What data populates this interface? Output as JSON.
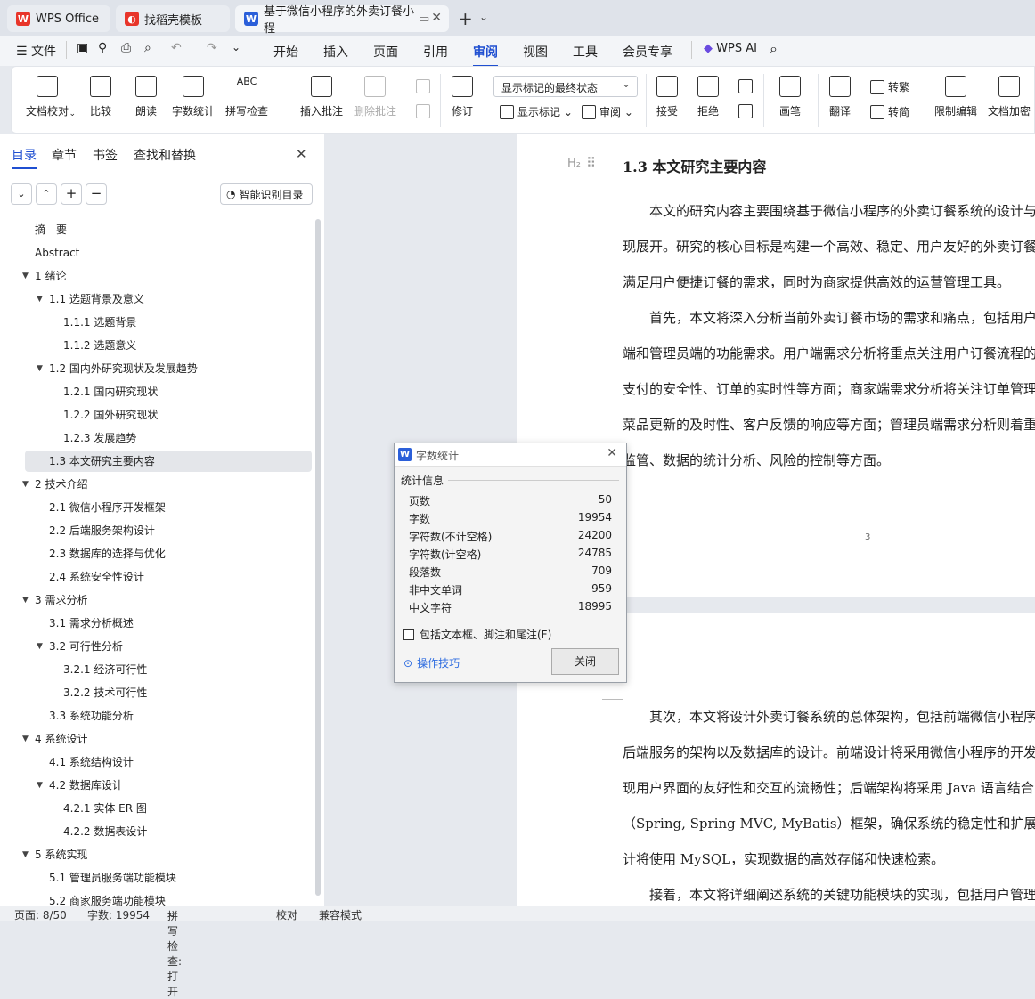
{
  "tabs": [
    {
      "label": "WPS Office"
    },
    {
      "label": "找稻壳模板"
    },
    {
      "label": "基于微信小程序的外卖订餐小程"
    }
  ],
  "menu": {
    "file": "文件",
    "items": [
      "开始",
      "插入",
      "页面",
      "引用",
      "审阅",
      "视图",
      "工具",
      "会员专享"
    ],
    "ai": "WPS AI"
  },
  "ribbon": {
    "big": [
      "文档校对",
      "比较",
      "朗读",
      "字数统计",
      "拼写检查",
      "插入批注",
      "删除批注",
      "修订",
      "接受",
      "拒绝",
      "画笔",
      "翻译",
      "限制编辑",
      "文档加密"
    ],
    "select": "显示标记的最终状态",
    "show_markup": "显示标记",
    "review": "审阅",
    "trad": "转繁",
    "simp": "转简"
  },
  "sidebar": {
    "tabs": [
      "目录",
      "章节",
      "书签",
      "查找和替换"
    ],
    "smart": "智能识别目录",
    "toc": [
      {
        "t": "摘　要",
        "l": 0
      },
      {
        "t": "Abstract",
        "l": 0
      },
      {
        "t": "1  绪论",
        "l": 0,
        "a": 1
      },
      {
        "t": "1.1  选题背景及意义",
        "l": 1,
        "a": 1
      },
      {
        "t": "1.1.1  选题背景",
        "l": 2
      },
      {
        "t": "1.1.2  选题意义",
        "l": 2
      },
      {
        "t": "1.2  国内外研究现状及发展趋势",
        "l": 1,
        "a": 1
      },
      {
        "t": "1.2.1  国内研究现状",
        "l": 2
      },
      {
        "t": "1.2.2  国外研究现状",
        "l": 2
      },
      {
        "t": "1.2.3  发展趋势",
        "l": 2
      },
      {
        "t": "1.3  本文研究主要内容",
        "l": 1,
        "hl": 1
      },
      {
        "t": "2  技术介绍",
        "l": 0,
        "a": 1
      },
      {
        "t": "2.1  微信小程序开发框架",
        "l": 1
      },
      {
        "t": "2.2  后端服务架构设计",
        "l": 1
      },
      {
        "t": "2.3  数据库的选择与优化",
        "l": 1
      },
      {
        "t": "2.4  系统安全性设计",
        "l": 1
      },
      {
        "t": "3  需求分析",
        "l": 0,
        "a": 1
      },
      {
        "t": "3.1  需求分析概述",
        "l": 1
      },
      {
        "t": "3.2  可行性分析",
        "l": 1,
        "a": 1
      },
      {
        "t": "3.2.1  经济可行性",
        "l": 2
      },
      {
        "t": "3.2.2  技术可行性",
        "l": 2
      },
      {
        "t": "3.3  系统功能分析",
        "l": 1
      },
      {
        "t": "4  系统设计",
        "l": 0,
        "a": 1
      },
      {
        "t": "4.1 系统结构设计",
        "l": 1
      },
      {
        "t": "4.2  数据库设计",
        "l": 1,
        "a": 1
      },
      {
        "t": "4.2.1  实体 ER 图",
        "l": 2
      },
      {
        "t": "4.2.2  数据表设计",
        "l": 2
      },
      {
        "t": "5  系统实现",
        "l": 0,
        "a": 1
      },
      {
        "t": "5.1  管理员服务端功能模块",
        "l": 1
      },
      {
        "t": "5.2  商家服务端功能模块",
        "l": 1
      }
    ]
  },
  "doc": {
    "heading_marker": "H₂",
    "heading": "1.3  本文研究主要内容",
    "p1": [
      "　　本文的研究内容主要围绕基于微信小程序的外卖订餐系统的设计与实",
      "现展开。研究的核心目标是构建一个高效、稳定、用户友好的外卖订餐",
      "满足用户便捷订餐的需求，同时为商家提供高效的运营管理工具。"
    ],
    "p2": [
      "　　首先，本文将深入分析当前外卖订餐市场的需求和痛点，包括用户端",
      "端和管理员端的功能需求。用户端需求分析将重点关注用户订餐流程的便",
      "支付的安全性、订单的实时性等方面；商家端需求分析将关注订单管理的",
      "菜品更新的及时性、客户反馈的响应等方面；管理员端需求分析则着重于",
      "监管、数据的统计分析、风险的控制等方面。"
    ],
    "page_number": "3",
    "p3": [
      "　　其次，本文将设计外卖订餐系统的总体架构，包括前端微信小程序的",
      "后端服务的架构以及数据库的设计。前端设计将采用微信小程序的开发框",
      "现用户界面的友好性和交互的流畅性；后端架构将采用 Java 语言结合",
      "（Spring, Spring MVC, MyBatis）框架，确保系统的稳定性和扩展性",
      "计将使用 MySQL，实现数据的高效存储和快速检索。",
      "　　接着，本文将详细阐述系统的关键功能模块的实现，包括用户管理"
    ]
  },
  "dialog": {
    "title": "字数统计",
    "section": "统计信息",
    "rows": [
      {
        "k": "页数",
        "v": "50"
      },
      {
        "k": "字数",
        "v": "19954"
      },
      {
        "k": "字符数(不计空格)",
        "v": "24200"
      },
      {
        "k": "字符数(计空格)",
        "v": "24785"
      },
      {
        "k": "段落数",
        "v": "709"
      },
      {
        "k": "非中文单词",
        "v": "959"
      },
      {
        "k": "中文字符",
        "v": "18995"
      }
    ],
    "checkbox": "包括文本框、脚注和尾注(F)",
    "tips": "操作技巧",
    "close": "关闭"
  },
  "status": {
    "page": "页面: 8/50",
    "words": "字数: 19954",
    "spell": "拼写检查: 打开",
    "proof": "校对",
    "compat": "兼容模式"
  }
}
